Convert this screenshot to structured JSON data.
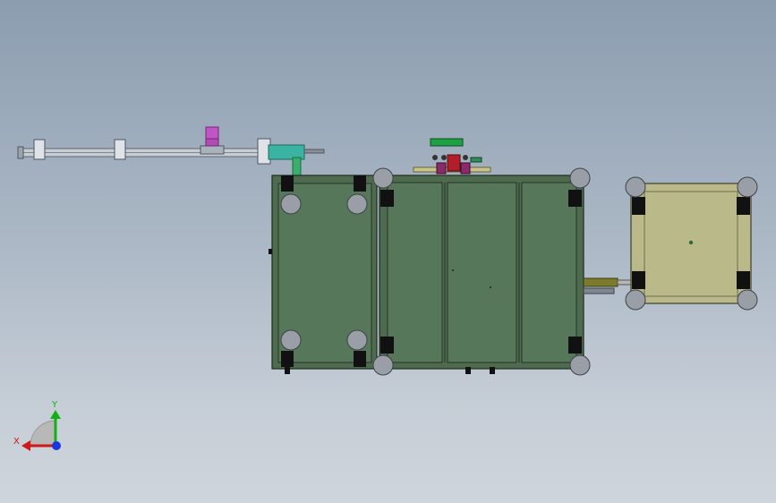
{
  "viewport": {
    "background_top": "#8c9db0",
    "background_bottom": "#cfd5dc"
  },
  "colors": {
    "frame_green": "#4f6b4f",
    "frame_green_dark": "#3a5239",
    "panel_green": "#56775a",
    "table_beige": "#b9b98a",
    "table_beige_dark": "#8f9066",
    "caster_gray": "#9a9ea6",
    "foot_black": "#111111",
    "rail_gray": "#c7cdd3",
    "cylinder_teal": "#3bb3a3",
    "cup_magenta": "#c155c6",
    "indicator_green": "#1ea045",
    "push_rod_olive": "#7b7b2a",
    "axis_x": "#d01818",
    "axis_y": "#12b012",
    "axis_z": "#1a36e0"
  },
  "triad": {
    "x_label": "X",
    "y_label": "Y"
  }
}
